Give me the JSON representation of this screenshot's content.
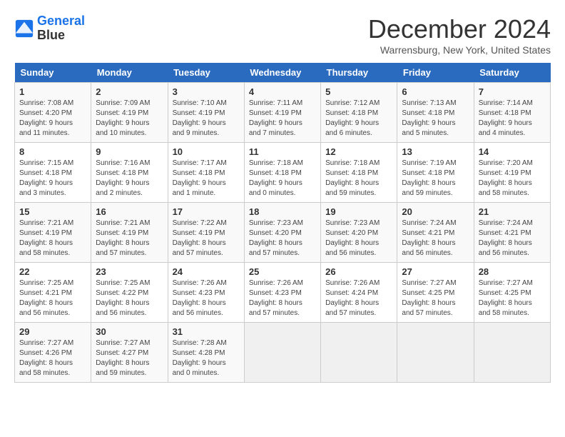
{
  "header": {
    "logo_line1": "General",
    "logo_line2": "Blue",
    "title": "December 2024",
    "subtitle": "Warrensburg, New York, United States"
  },
  "weekdays": [
    "Sunday",
    "Monday",
    "Tuesday",
    "Wednesday",
    "Thursday",
    "Friday",
    "Saturday"
  ],
  "weeks": [
    [
      {
        "day": "1",
        "sunrise": "7:08 AM",
        "sunset": "4:20 PM",
        "daylight": "9 hours and 11 minutes."
      },
      {
        "day": "2",
        "sunrise": "7:09 AM",
        "sunset": "4:19 PM",
        "daylight": "9 hours and 10 minutes."
      },
      {
        "day": "3",
        "sunrise": "7:10 AM",
        "sunset": "4:19 PM",
        "daylight": "9 hours and 9 minutes."
      },
      {
        "day": "4",
        "sunrise": "7:11 AM",
        "sunset": "4:19 PM",
        "daylight": "9 hours and 7 minutes."
      },
      {
        "day": "5",
        "sunrise": "7:12 AM",
        "sunset": "4:18 PM",
        "daylight": "9 hours and 6 minutes."
      },
      {
        "day": "6",
        "sunrise": "7:13 AM",
        "sunset": "4:18 PM",
        "daylight": "9 hours and 5 minutes."
      },
      {
        "day": "7",
        "sunrise": "7:14 AM",
        "sunset": "4:18 PM",
        "daylight": "9 hours and 4 minutes."
      }
    ],
    [
      {
        "day": "8",
        "sunrise": "7:15 AM",
        "sunset": "4:18 PM",
        "daylight": "9 hours and 3 minutes."
      },
      {
        "day": "9",
        "sunrise": "7:16 AM",
        "sunset": "4:18 PM",
        "daylight": "9 hours and 2 minutes."
      },
      {
        "day": "10",
        "sunrise": "7:17 AM",
        "sunset": "4:18 PM",
        "daylight": "9 hours and 1 minute."
      },
      {
        "day": "11",
        "sunrise": "7:18 AM",
        "sunset": "4:18 PM",
        "daylight": "9 hours and 0 minutes."
      },
      {
        "day": "12",
        "sunrise": "7:18 AM",
        "sunset": "4:18 PM",
        "daylight": "8 hours and 59 minutes."
      },
      {
        "day": "13",
        "sunrise": "7:19 AM",
        "sunset": "4:18 PM",
        "daylight": "8 hours and 59 minutes."
      },
      {
        "day": "14",
        "sunrise": "7:20 AM",
        "sunset": "4:19 PM",
        "daylight": "8 hours and 58 minutes."
      }
    ],
    [
      {
        "day": "15",
        "sunrise": "7:21 AM",
        "sunset": "4:19 PM",
        "daylight": "8 hours and 58 minutes."
      },
      {
        "day": "16",
        "sunrise": "7:21 AM",
        "sunset": "4:19 PM",
        "daylight": "8 hours and 57 minutes."
      },
      {
        "day": "17",
        "sunrise": "7:22 AM",
        "sunset": "4:19 PM",
        "daylight": "8 hours and 57 minutes."
      },
      {
        "day": "18",
        "sunrise": "7:23 AM",
        "sunset": "4:20 PM",
        "daylight": "8 hours and 57 minutes."
      },
      {
        "day": "19",
        "sunrise": "7:23 AM",
        "sunset": "4:20 PM",
        "daylight": "8 hours and 56 minutes."
      },
      {
        "day": "20",
        "sunrise": "7:24 AM",
        "sunset": "4:21 PM",
        "daylight": "8 hours and 56 minutes."
      },
      {
        "day": "21",
        "sunrise": "7:24 AM",
        "sunset": "4:21 PM",
        "daylight": "8 hours and 56 minutes."
      }
    ],
    [
      {
        "day": "22",
        "sunrise": "7:25 AM",
        "sunset": "4:21 PM",
        "daylight": "8 hours and 56 minutes."
      },
      {
        "day": "23",
        "sunrise": "7:25 AM",
        "sunset": "4:22 PM",
        "daylight": "8 hours and 56 minutes."
      },
      {
        "day": "24",
        "sunrise": "7:26 AM",
        "sunset": "4:23 PM",
        "daylight": "8 hours and 56 minutes."
      },
      {
        "day": "25",
        "sunrise": "7:26 AM",
        "sunset": "4:23 PM",
        "daylight": "8 hours and 57 minutes."
      },
      {
        "day": "26",
        "sunrise": "7:26 AM",
        "sunset": "4:24 PM",
        "daylight": "8 hours and 57 minutes."
      },
      {
        "day": "27",
        "sunrise": "7:27 AM",
        "sunset": "4:25 PM",
        "daylight": "8 hours and 57 minutes."
      },
      {
        "day": "28",
        "sunrise": "7:27 AM",
        "sunset": "4:25 PM",
        "daylight": "8 hours and 58 minutes."
      }
    ],
    [
      {
        "day": "29",
        "sunrise": "7:27 AM",
        "sunset": "4:26 PM",
        "daylight": "8 hours and 58 minutes."
      },
      {
        "day": "30",
        "sunrise": "7:27 AM",
        "sunset": "4:27 PM",
        "daylight": "8 hours and 59 minutes."
      },
      {
        "day": "31",
        "sunrise": "7:28 AM",
        "sunset": "4:28 PM",
        "daylight": "9 hours and 0 minutes."
      },
      null,
      null,
      null,
      null
    ]
  ]
}
